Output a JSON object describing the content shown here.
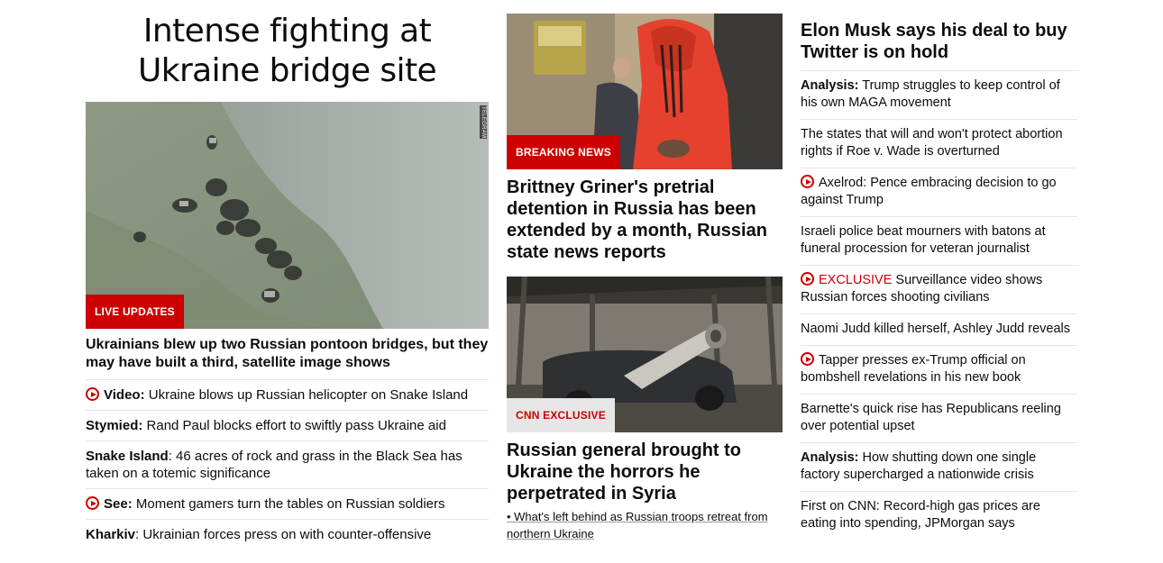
{
  "left": {
    "hero_title": "Intense fighting at Ukraine bridge site",
    "image_watermark": "TELEGRAM",
    "badge": "LIVE UPDATES",
    "lead_headline": "Ukrainians blew up two Russian pontoon bridges, but they may have built a third, satellite image shows",
    "items": [
      {
        "prefix": "Video:",
        "text": " Ukraine blows up Russian helicopter on Snake Island",
        "video": true
      },
      {
        "prefix": "Stymied:",
        "text": " Rand Paul blocks effort to swiftly pass Ukraine aid",
        "video": false
      },
      {
        "prefix": "Snake Island",
        "text": ": 46 acres of rock and grass in the Black Sea has taken on a totemic significance",
        "video": false
      },
      {
        "prefix": "See:",
        "text": " Moment gamers turn the tables on Russian soldiers",
        "video": true
      },
      {
        "prefix": "Kharkiv",
        "text": ": Ukrainian forces press on with counter-offensive",
        "video": false
      }
    ]
  },
  "middle": {
    "story1": {
      "badge": "BREAKING NEWS",
      "headline": "Brittney Griner's pretrial detention in Russia has been extended by a month, Russian state news reports"
    },
    "story2": {
      "badge": "CNN EXCLUSIVE",
      "headline": "Russian general brought to Ukraine the horrors he perpetrated in Syria",
      "sub_link": "• What's left behind as Russian troops retreat from northern Ukraine"
    }
  },
  "right": {
    "headline": "Elon Musk says his deal to buy Twitter is on hold",
    "items": [
      {
        "prefix": "Analysis:",
        "text": " Trump struggles to keep control of his own MAGA movement",
        "video": false,
        "red_prefix": ""
      },
      {
        "prefix": "",
        "text": "The states that will and won't protect abortion rights if Roe v. Wade is overturned",
        "video": false,
        "red_prefix": ""
      },
      {
        "prefix": "",
        "text": "Axelrod: Pence embracing decision to go against Trump",
        "video": true,
        "red_prefix": ""
      },
      {
        "prefix": "",
        "text": "Israeli police beat mourners with batons at funeral procession for veteran journalist",
        "video": false,
        "red_prefix": ""
      },
      {
        "prefix": "",
        "text": " Surveillance video shows Russian forces shooting civilians",
        "video": true,
        "red_prefix": "EXCLUSIVE"
      },
      {
        "prefix": "",
        "text": "Naomi Judd killed herself, Ashley Judd reveals",
        "video": false,
        "red_prefix": ""
      },
      {
        "prefix": "",
        "text": "Tapper presses ex-Trump official on bombshell revelations in his new book",
        "video": true,
        "red_prefix": ""
      },
      {
        "prefix": "",
        "text": "Barnette's quick rise has Republicans reeling over potential upset",
        "video": false,
        "red_prefix": ""
      },
      {
        "prefix": "Analysis:",
        "text": " How shutting down one single factory supercharged a nationwide crisis",
        "video": false,
        "red_prefix": ""
      },
      {
        "prefix": "",
        "text": "First on CNN: Record-high gas prices are eating into spending, JPMorgan says",
        "video": false,
        "red_prefix": ""
      }
    ]
  },
  "colors": {
    "accent": "#cc0000",
    "divider": "#e6e6e6",
    "text": "#0c0c0c"
  }
}
